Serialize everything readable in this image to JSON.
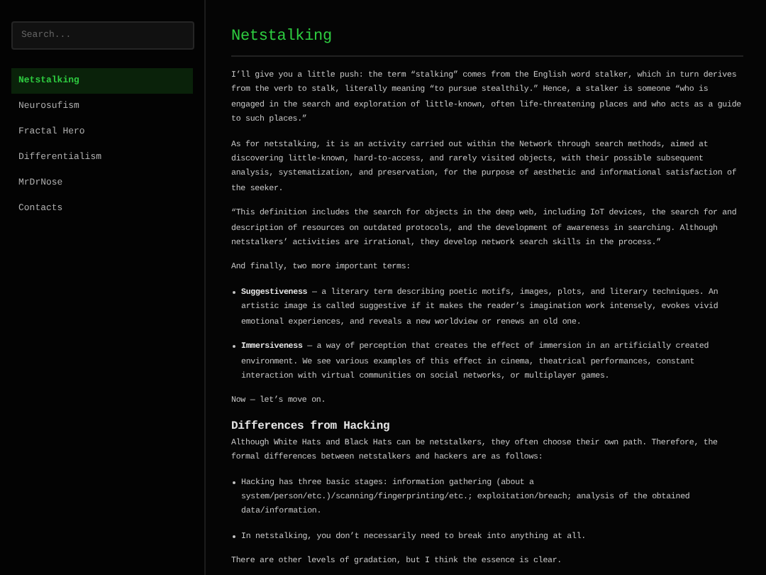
{
  "sidebar": {
    "search": {
      "placeholder": "Search..."
    },
    "items": [
      {
        "label": "Netstalking",
        "selected": true
      },
      {
        "label": "Neurosufism",
        "selected": false
      },
      {
        "label": "Fractal Hero",
        "selected": false
      },
      {
        "label": "Differentialism",
        "selected": false
      },
      {
        "label": "MrDrNose",
        "selected": false
      },
      {
        "label": "Contacts",
        "selected": false
      }
    ]
  },
  "article": {
    "title": "Netstalking",
    "blocks": [
      {
        "kind": "paragraph",
        "text": "I’ll give you a little push: the term “stalking” comes from the English word stalker, which in turn derives from the verb to stalk, literally meaning “to pursue stealthily.” Hence, a stalker is someone “who is engaged in the search and exploration of little-known, often life-threatening places and who acts as a guide to such places.”"
      },
      {
        "kind": "paragraph",
        "text": "As for netstalking, it is an activity carried out within the Network through search methods, aimed at discovering little-known, hard-to-access, and rarely visited objects, with their possible subsequent analysis, systematization, and preservation, for the purpose of aesthetic and informational satisfaction of the seeker."
      },
      {
        "kind": "paragraph",
        "text": "“This definition includes the search for objects in the deep web, including IoT devices, the search for and description of resources on outdated protocols, and the development of awareness in searching. Although netstalkers’ activities are irrational, they develop network search skills in the process.”"
      },
      {
        "kind": "paragraph",
        "text": "And finally, two more important terms:"
      },
      {
        "kind": "bullet",
        "text": "**Suggestiveness** — a literary term describing poetic motifs, images, plots, and literary techniques. An artistic image is called suggestive if it makes the reader’s imagination work intensely, evokes vivid emotional experiences, and reveals a new worldview or renews an old one."
      },
      {
        "kind": "bullet",
        "text": "**Immersiveness** — a way of perception that creates the effect of immersion in an artificially created environment. We see various examples of this effect in cinema, theatrical performances, constant interaction with virtual communities on social networks, or multiplayer games."
      },
      {
        "kind": "paragraph",
        "text": "Now — let’s move on."
      },
      {
        "kind": "heading",
        "text": "Differences from Hacking"
      },
      {
        "kind": "lead",
        "text": "Although White Hats and Black Hats can be netstalkers, they often choose their own path. Therefore, the formal differences between netstalkers and hackers are as follows:"
      },
      {
        "kind": "bullet",
        "text": "Hacking has three basic stages: information gathering (about a system/person/etc.)/scanning/fingerprinting/etc.; exploitation/breach; analysis of the obtained data/information."
      },
      {
        "kind": "bullet",
        "text": "In netstalking, you don’t necessarily need to break into anything at all."
      },
      {
        "kind": "paragraph",
        "text": "There are other levels of gradation, but I think the essence is clear."
      }
    ]
  }
}
